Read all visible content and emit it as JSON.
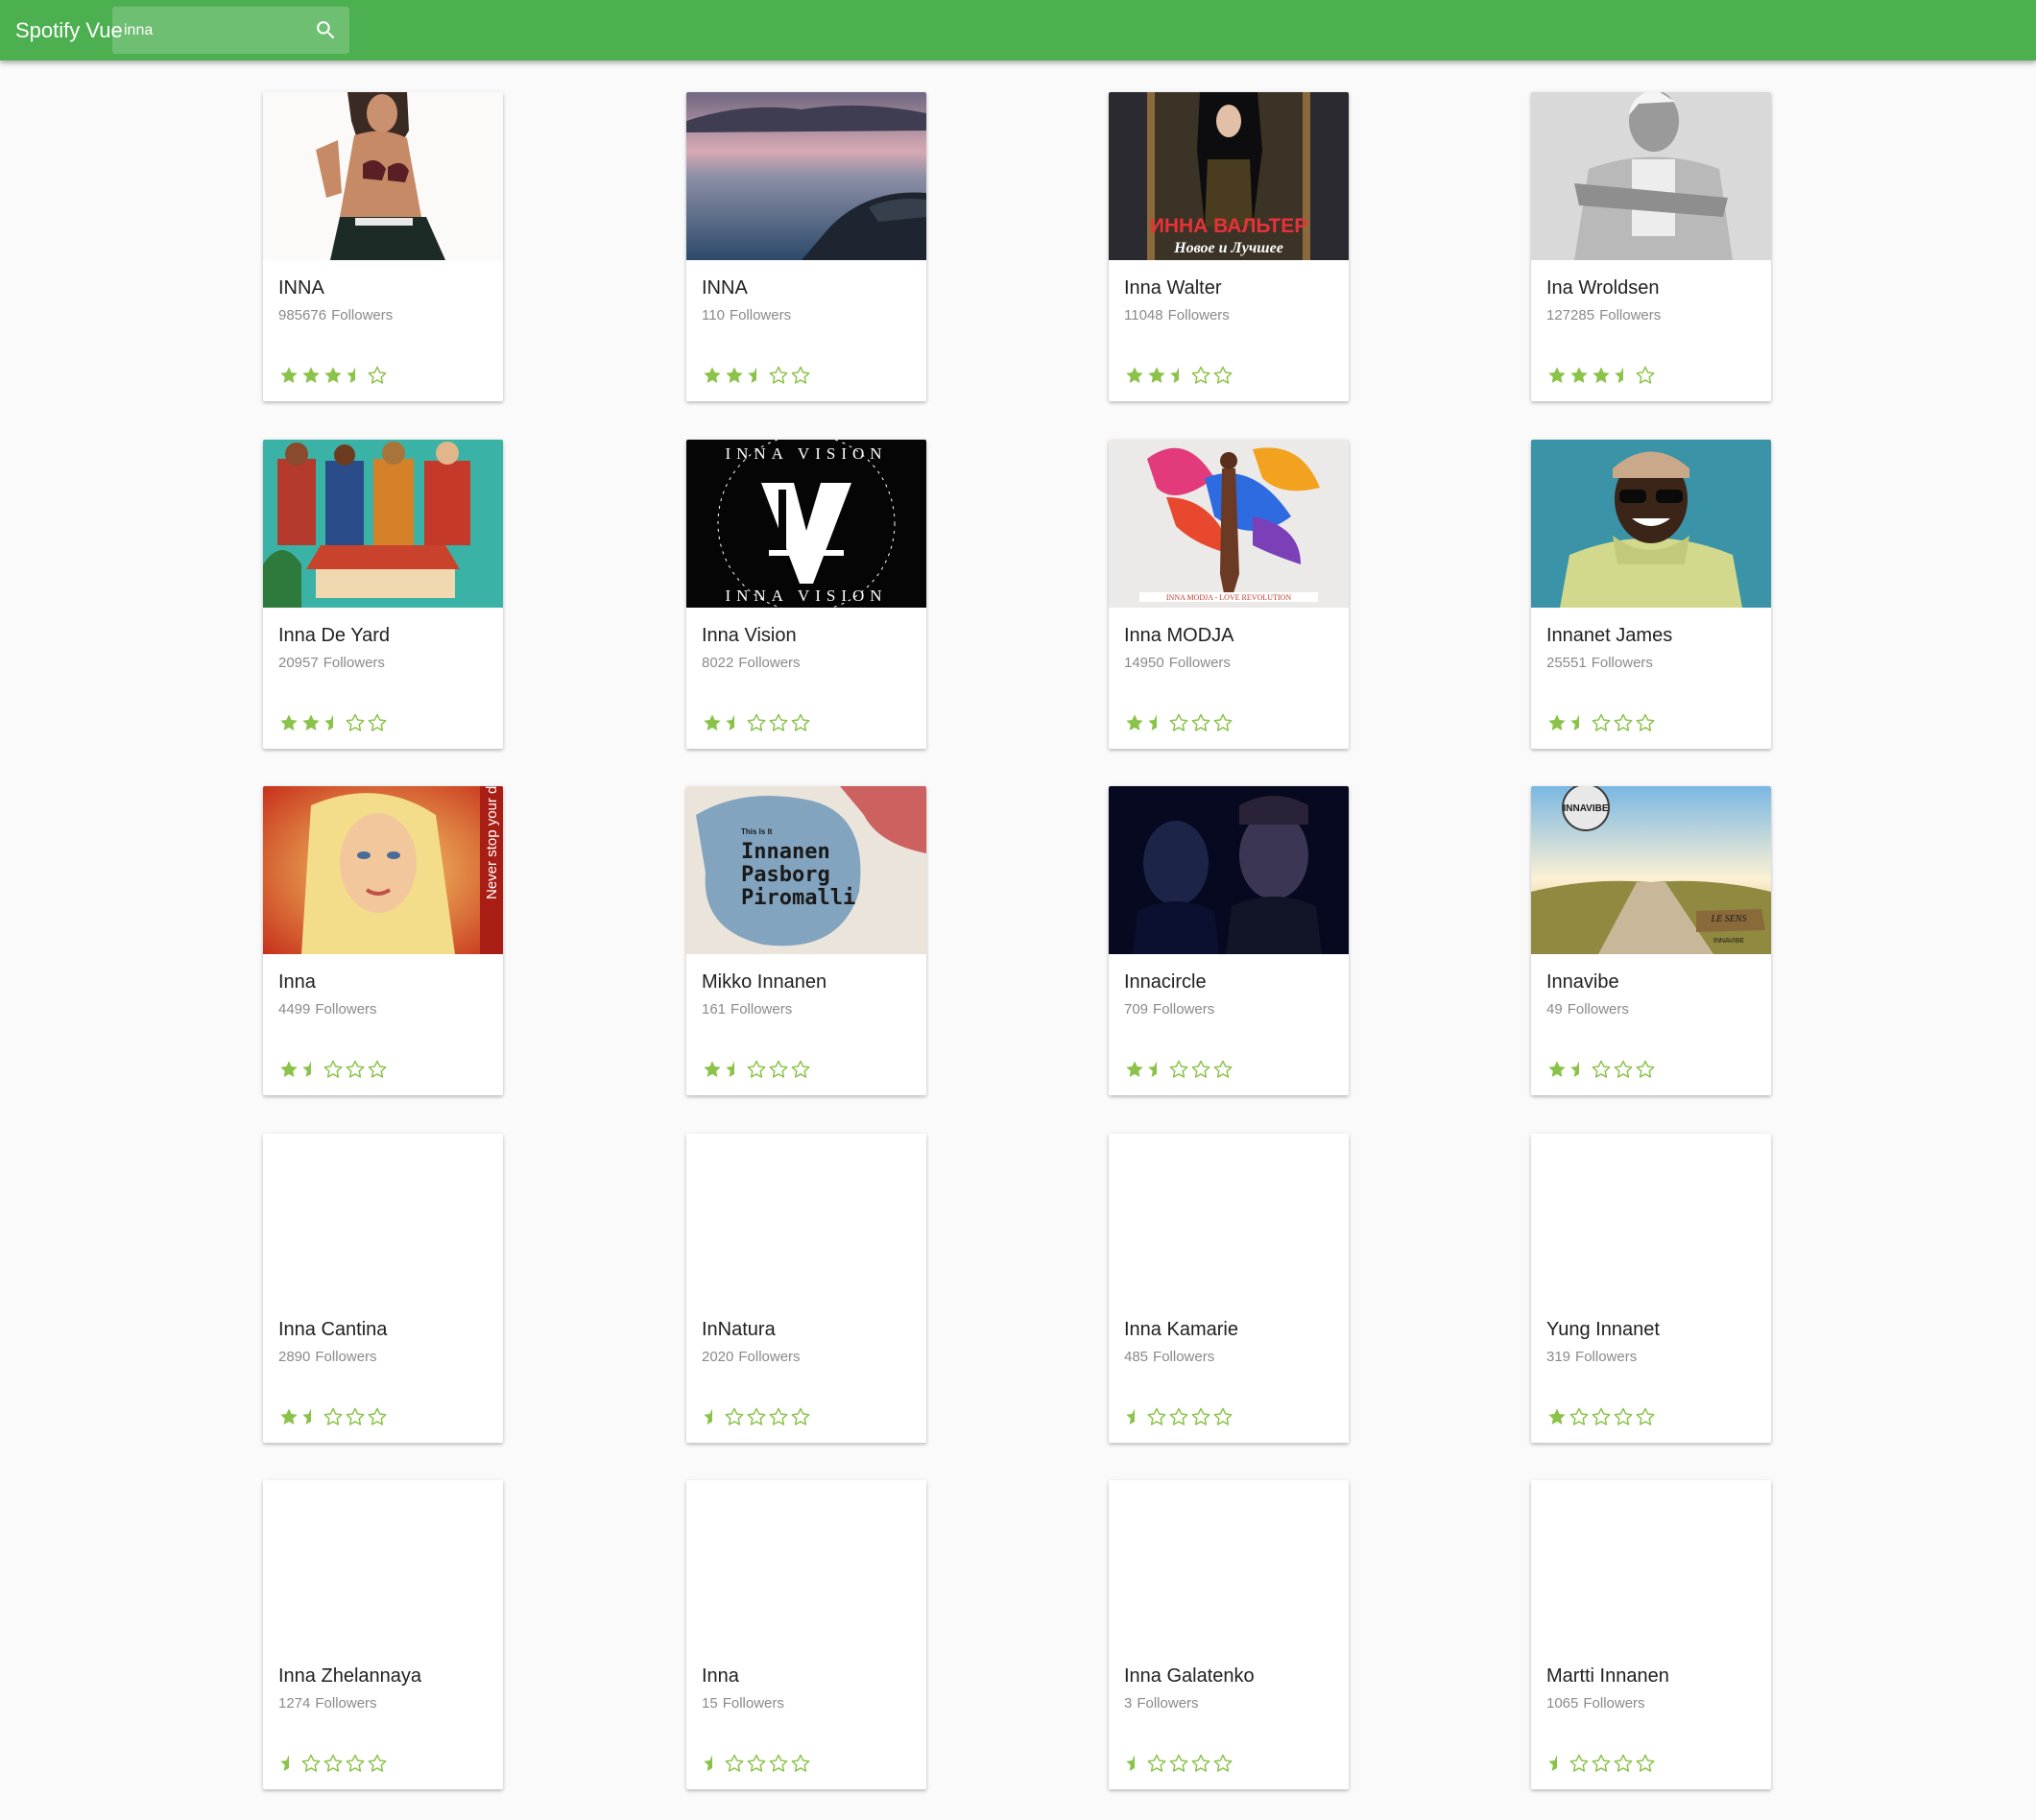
{
  "app": {
    "title": "Spotify Vue",
    "accent_color": "#4caf50",
    "star_color": "#8bc34a"
  },
  "search": {
    "value": "inna",
    "icon": "search-icon"
  },
  "artists": [
    {
      "name": "INNA",
      "followers": "985676",
      "followers_label": "Followers",
      "rating": 3.5,
      "image": "woman-in-bikini-photo"
    },
    {
      "name": "INNA",
      "followers": "110",
      "followers_label": "Followers",
      "rating": 2.5,
      "image": "sea-coast-at-dusk-photo"
    },
    {
      "name": "Inna Walter",
      "followers": "11048",
      "followers_label": "Followers",
      "rating": 2.5,
      "image": "album-cover-inna-walter",
      "image_text": [
        "ИННА ВАЛЬТЕР",
        "Новое и Лучшее"
      ]
    },
    {
      "name": "Ina Wroldsen",
      "followers": "127285",
      "followers_label": "Followers",
      "rating": 3.5,
      "image": "black-and-white-portrait-photo"
    },
    {
      "name": "Inna De Yard",
      "followers": "20957",
      "followers_label": "Followers",
      "rating": 2.5,
      "image": "illustrated-band-artwork"
    },
    {
      "name": "Inna Vision",
      "followers": "8022",
      "followers_label": "Followers",
      "rating": 1.5,
      "image": "inna-vision-logo",
      "image_text": [
        "INNA VISION",
        "INNA VISION"
      ]
    },
    {
      "name": "Inna MODJA",
      "followers": "14950",
      "followers_label": "Followers",
      "rating": 1.5,
      "image": "colorful-dancer-artwork",
      "image_text": [
        "INNA MODJA - LOVE REVOLUTION"
      ]
    },
    {
      "name": "Innanet James",
      "followers": "25551",
      "followers_label": "Followers",
      "rating": 1.5,
      "image": "smiling-man-in-hoodie-photo"
    },
    {
      "name": "Inna",
      "followers": "4499",
      "followers_label": "Followers",
      "rating": 1.5,
      "image": "blonde-woman-album-cover",
      "image_text": [
        "Never stop your da"
      ]
    },
    {
      "name": "Mikko Innanen",
      "followers": "161",
      "followers_label": "Followers",
      "rating": 1.5,
      "image": "watercolor-album-cover",
      "image_text": [
        "This Is It",
        "Innanen",
        "Pasborg",
        "Piromalli"
      ]
    },
    {
      "name": "Innacircle",
      "followers": "709",
      "followers_label": "Followers",
      "rating": 1.5,
      "image": "two-men-dark-portrait"
    },
    {
      "name": "Innavibe",
      "followers": "49",
      "followers_label": "Followers",
      "rating": 1.5,
      "image": "boardwalk-sunset-artwork",
      "image_text": [
        "INNAVIBE",
        "LE SENS",
        "INNAVIBE"
      ]
    },
    {
      "name": "Inna Cantina",
      "followers": "2890",
      "followers_label": "Followers",
      "rating": 1.5,
      "image": "none"
    },
    {
      "name": "InNatura",
      "followers": "2020",
      "followers_label": "Followers",
      "rating": 0.5,
      "image": "none"
    },
    {
      "name": "Inna Kamarie",
      "followers": "485",
      "followers_label": "Followers",
      "rating": 0.5,
      "image": "none"
    },
    {
      "name": "Yung Innanet",
      "followers": "319",
      "followers_label": "Followers",
      "rating": 1,
      "image": "none"
    },
    {
      "name": "Inna Zhelannaya",
      "followers": "1274",
      "followers_label": "Followers",
      "rating": 0.5,
      "image": "none"
    },
    {
      "name": "Inna",
      "followers": "15",
      "followers_label": "Followers",
      "rating": 0.5,
      "image": "none"
    },
    {
      "name": "Inna Galatenko",
      "followers": "3",
      "followers_label": "Followers",
      "rating": 0.5,
      "image": "none"
    },
    {
      "name": "Martti Innanen",
      "followers": "1065",
      "followers_label": "Followers",
      "rating": 0.5,
      "image": "none"
    }
  ]
}
